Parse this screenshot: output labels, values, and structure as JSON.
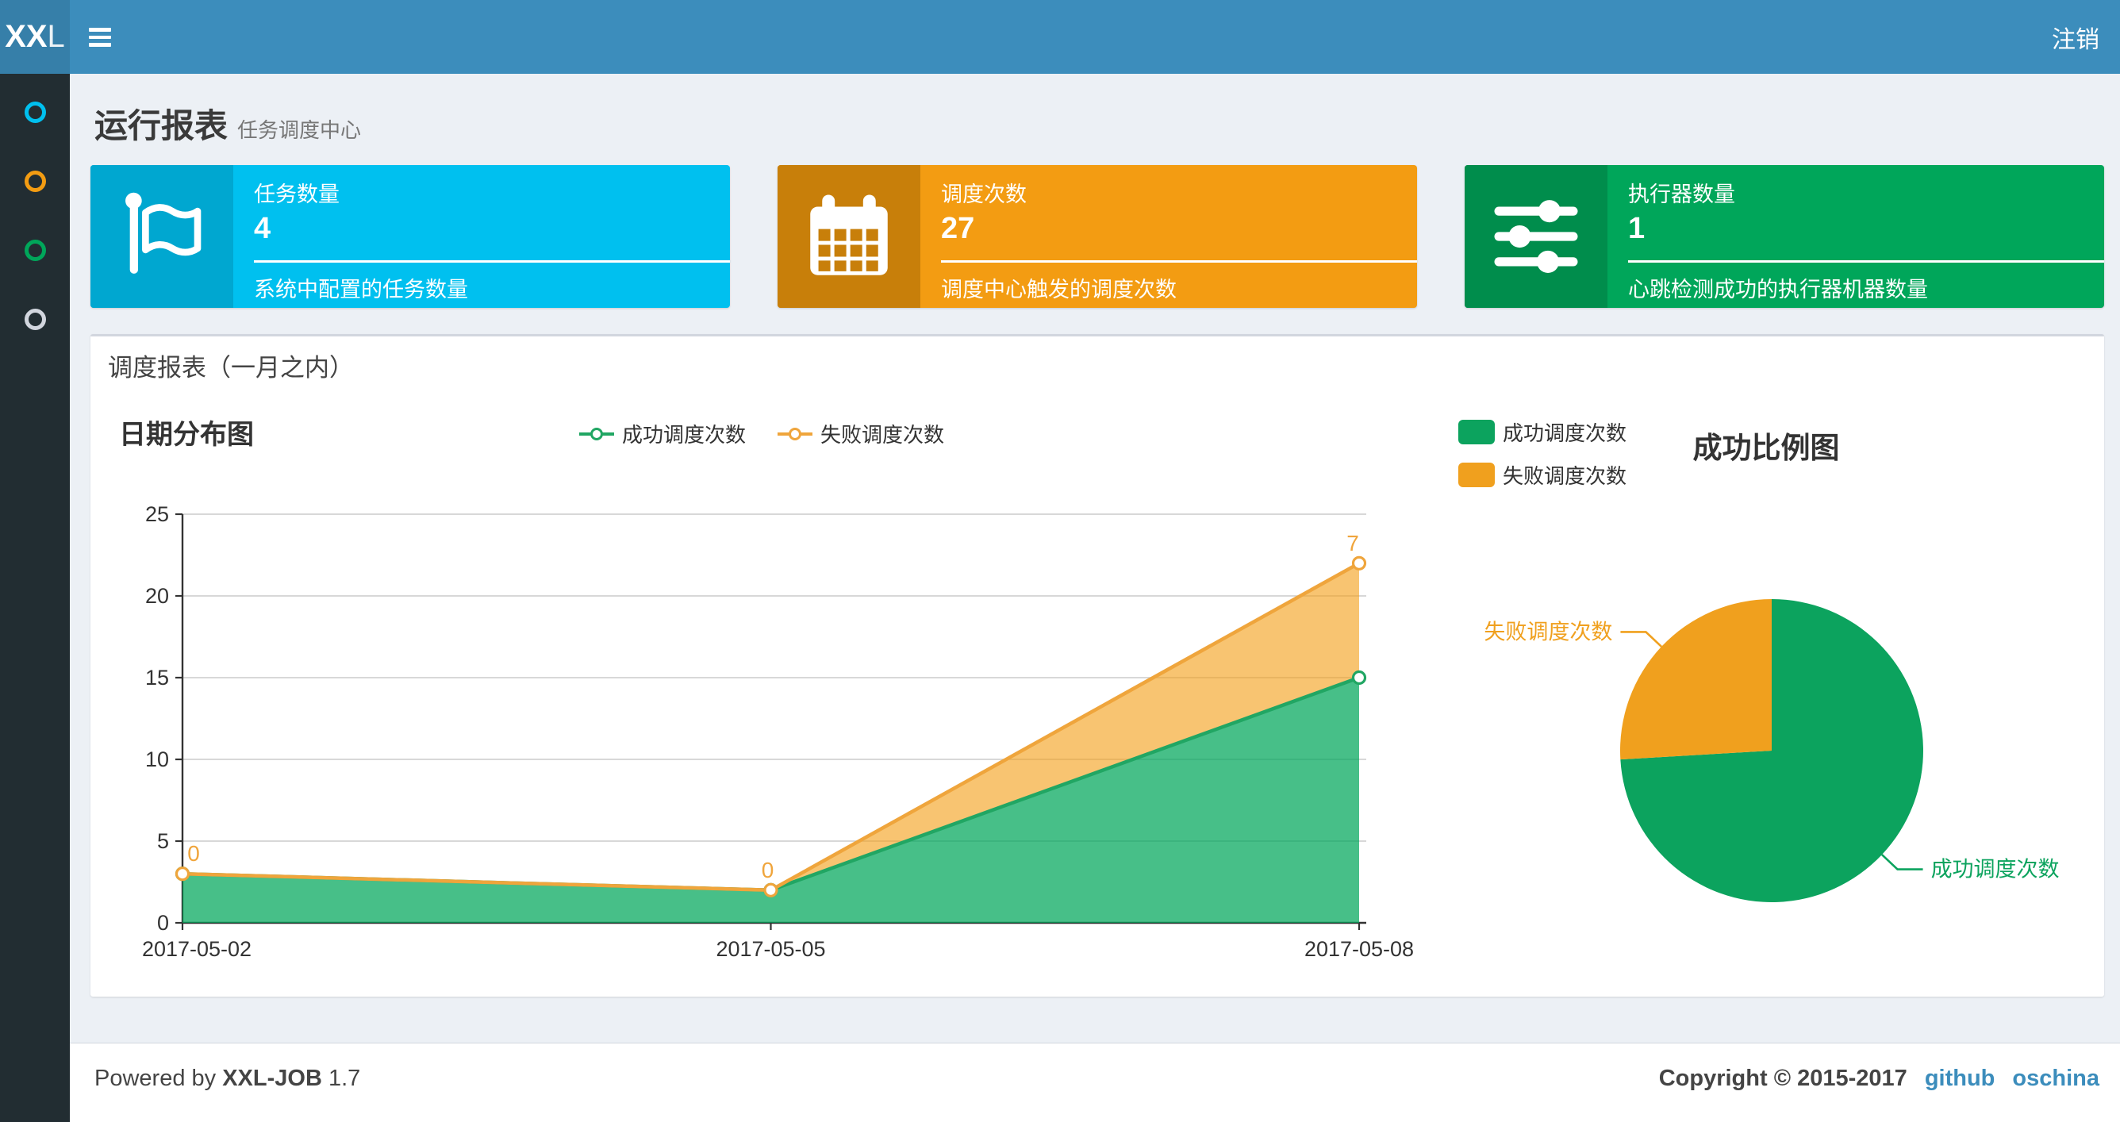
{
  "navbar": {
    "logo_bold": "XX",
    "logo_light": "L",
    "logout_label": "注销"
  },
  "sidebar": {
    "items": [
      {
        "id": "report",
        "icon": "circle-o-icon",
        "color": "#00c0ef"
      },
      {
        "id": "jobs",
        "icon": "circle-o-icon",
        "color": "#f39c12"
      },
      {
        "id": "joblog",
        "icon": "circle-o-icon",
        "color": "#00a65a"
      },
      {
        "id": "executors",
        "icon": "circle-o-icon",
        "color": "#d2d6de"
      }
    ]
  },
  "page_header": {
    "title": "运行报表",
    "subtitle": "任务调度中心"
  },
  "info_boxes": [
    {
      "title": "任务数量",
      "value": "4",
      "desc": "系统中配置的任务数量",
      "color": "#00c0ef",
      "icon_bg": "#00a7d0",
      "icon": "flag-icon"
    },
    {
      "title": "调度次数",
      "value": "27",
      "desc": "调度中心触发的调度次数",
      "color": "#f39c12",
      "icon_bg": "#c87f0a",
      "icon": "calendar-icon"
    },
    {
      "title": "执行器数量",
      "value": "1",
      "desc": "心跳检测成功的执行器机器数量",
      "color": "#00a65a",
      "icon_bg": "#008d4c",
      "icon": "sliders-icon"
    }
  ],
  "panel": {
    "title": "调度报表（一月之内）"
  },
  "chart_data": [
    {
      "type": "area",
      "title": "日期分布图",
      "categories": [
        "2017-05-02",
        "2017-05-05",
        "2017-05-08"
      ],
      "stacked": true,
      "series": [
        {
          "name": "成功调度次数",
          "values": [
            3,
            2,
            15
          ],
          "line_color": "#21a663",
          "area_color": "#00a65a",
          "area_opacity": 0.72
        },
        {
          "name": "失败调度次数",
          "values": [
            0,
            0,
            7
          ],
          "line_color": "#efa53c",
          "area_color": "#f39c12",
          "area_opacity": 0.6
        }
      ],
      "point_labels": {
        "series": "失败调度次数",
        "values": [
          "0",
          "0",
          "7"
        ],
        "color": "#f0a53c"
      },
      "xlabel": "",
      "ylabel": "",
      "ylim": [
        0,
        25
      ],
      "y_ticks": [
        0,
        5,
        10,
        15,
        20,
        25
      ],
      "grid": true,
      "legend_position": "top-center"
    },
    {
      "type": "pie",
      "title": "成功比例图",
      "slices": [
        {
          "name": "成功调度次数",
          "value": 20,
          "color": "#0ca35e"
        },
        {
          "name": "失败调度次数",
          "value": 7,
          "color": "#f0a01e"
        }
      ],
      "start_angle": 90,
      "clockwise": true,
      "label_lines": true,
      "legend_position": "top-left"
    }
  ],
  "footer": {
    "powered_prefix": "Powered by",
    "product": "XXL-JOB",
    "version": "1.7",
    "copyright": "Copyright © 2015-2017",
    "links": [
      {
        "label": "github"
      },
      {
        "label": "oschina"
      }
    ]
  },
  "theme": {
    "navbar": "#3c8dbc",
    "logo_bg": "#367fa9",
    "sidebar": "#222d32",
    "content_bg": "#ecf0f5",
    "footer_border": "#d2d6de",
    "link": "#3c8dbc",
    "text": "#333333",
    "subtitle": "#777777",
    "grid_line": "#cccccc",
    "axis": "#333333"
  }
}
